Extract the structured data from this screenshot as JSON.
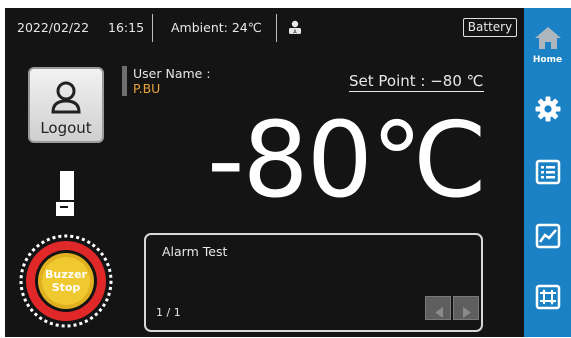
{
  "status_bar": {
    "date": "2022/02/22",
    "time": "16:15",
    "ambient": "Ambient: 24℃",
    "battery": "Battery"
  },
  "user": {
    "title": "User Name :",
    "name": "P.BU"
  },
  "logout_label": "Logout",
  "set_point": "Set Point : −80  ℃",
  "temperature": "-80℃",
  "alarm": {
    "message": "Alarm Test",
    "page": "1 / 1"
  },
  "buzzer_label_line1": "Buzzer",
  "buzzer_label_line2": "Stop",
  "sidebar": {
    "home_label": "Home",
    "icons": [
      "home-icon",
      "gear-icon",
      "list-icon",
      "chart-icon",
      "adjust-icon"
    ]
  },
  "colors": {
    "background": "#141414",
    "sidebar": "#1a82c4",
    "username": "#e8a33a",
    "buzzer_ring": "#e02828",
    "buzzer_center": "#e0b020"
  }
}
